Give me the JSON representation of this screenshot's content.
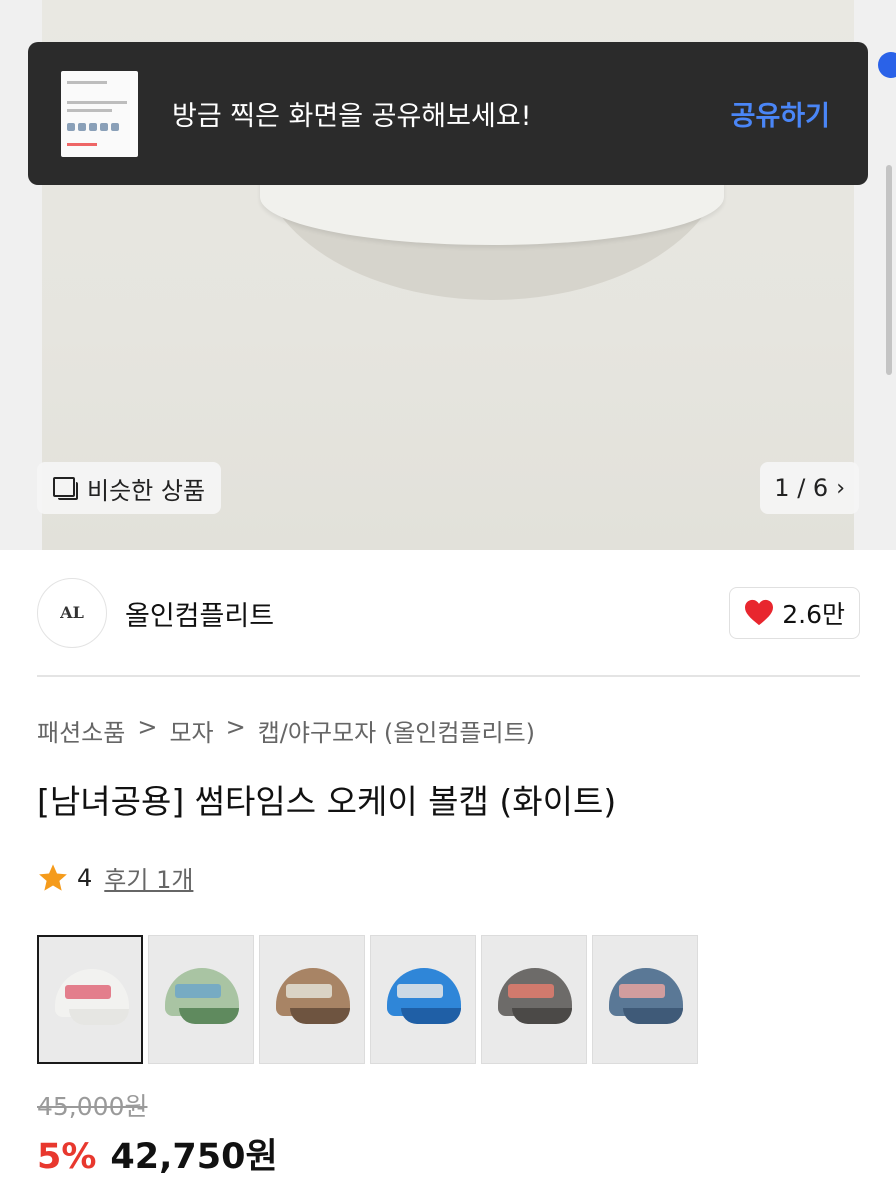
{
  "toast": {
    "message": "방금 찍은 화면을 공유해보세요!",
    "action": "공유하기"
  },
  "gallery": {
    "similar_label": "비슷한 상품",
    "counter": "1 / 6"
  },
  "brand": {
    "name": "올인컴플리트",
    "logo_text": "AL",
    "like_count": "2.6만"
  },
  "breadcrumb": [
    "패션소품",
    "모자",
    "캡/야구모자 (올인컴플리트)"
  ],
  "product": {
    "title": "[남녀공용] 썸타임스 오케이 볼캡 (화이트)",
    "rating": "4",
    "review_label": "후기 1개",
    "original_price": "45,000원",
    "discount": "5%",
    "sale_price": "42,750원"
  },
  "swatches": [
    {
      "name": "white",
      "color": "#f2f2f0",
      "brim": "#e6e6e3",
      "emb": "#e06a7a"
    },
    {
      "name": "mint",
      "color": "#a9c4a3",
      "brim": "#5f8a5e",
      "emb": "#6fa7c9"
    },
    {
      "name": "brown",
      "color": "#a88465",
      "brim": "#6e5440",
      "emb": "#e3e0d6"
    },
    {
      "name": "blue",
      "color": "#2f86d8",
      "brim": "#1f5fa6",
      "emb": "#e8e8e8"
    },
    {
      "name": "charcoal",
      "color": "#6d6b69",
      "brim": "#4b4947",
      "emb": "#e37d6e"
    },
    {
      "name": "denim",
      "color": "#5a7896",
      "brim": "#3f5a78",
      "emb": "#e6a3a0"
    }
  ],
  "colors": {
    "accent_blue": "#4a86f7",
    "discount_red": "#e8382e",
    "heart_red": "#e8262e",
    "star_orange": "#f59b1b"
  }
}
